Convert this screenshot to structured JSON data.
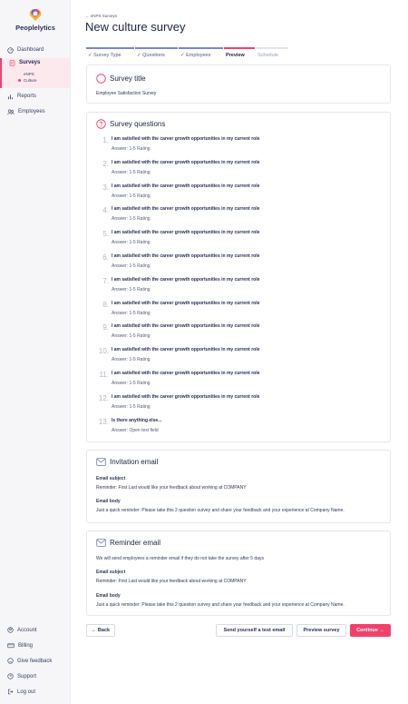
{
  "app": {
    "brand": "Peoplelytics"
  },
  "sidebar": {
    "items": [
      {
        "label": "Dashboard",
        "icon": "dashboard-icon"
      },
      {
        "label": "Surveys",
        "icon": "surveys-icon"
      },
      {
        "label": "Reports",
        "icon": "reports-icon"
      },
      {
        "label": "Employees",
        "icon": "employees-icon"
      }
    ],
    "survey_sub": [
      "eNPS",
      "Culture"
    ],
    "bottom": [
      {
        "label": "Account",
        "icon": "account-icon"
      },
      {
        "label": "Billing",
        "icon": "billing-icon"
      },
      {
        "label": "Give feedback",
        "icon": "feedback-icon"
      },
      {
        "label": "Support",
        "icon": "support-icon"
      },
      {
        "label": "Log out",
        "icon": "logout-icon"
      }
    ]
  },
  "header": {
    "breadcrumb": "← eNPS Surveys",
    "title": "New culture survey"
  },
  "steps": [
    {
      "label": "✓ Survey Type",
      "state": "done"
    },
    {
      "label": "✓ Questions",
      "state": "done"
    },
    {
      "label": "✓ Employees",
      "state": "done"
    },
    {
      "label": "Preview",
      "state": "active"
    },
    {
      "label": "Schedule",
      "state": "future"
    }
  ],
  "title_card": {
    "heading": "Survey title",
    "value": "Employee Satisfaction Survey"
  },
  "questions_card": {
    "heading": "Survey questions",
    "questions": [
      {
        "num": "1.",
        "text": "I am satisfied with the career growth opportunities in my current role",
        "answer": "Answer: 1-5 Rating"
      },
      {
        "num": "2.",
        "text": "I am satisfied with the career growth opportunities in my current role",
        "answer": "Answer: 1-5 Rating"
      },
      {
        "num": "3.",
        "text": "I am satisfied with the career growth opportunities in my current role",
        "answer": "Answer: 1-5 Rating"
      },
      {
        "num": "4.",
        "text": "I am satisfied with the career growth opportunities in my current role",
        "answer": "Answer: 1-5 Rating"
      },
      {
        "num": "5.",
        "text": "I am satisfied with the career growth opportunities in my current role",
        "answer": "Answer: 1-5 Rating"
      },
      {
        "num": "6.",
        "text": "I am satisfied with the career growth opportunities in my current role",
        "answer": "Answer: 1-5 Rating"
      },
      {
        "num": "7.",
        "text": "I am satisfied with the career growth opportunities in my current role",
        "answer": "Answer: 1-5 Rating"
      },
      {
        "num": "8.",
        "text": "I am satisfied with the career growth opportunities in my current role",
        "answer": "Answer: 1-5 Rating"
      },
      {
        "num": "9.",
        "text": "I am satisfied with the career growth opportunities in my current role",
        "answer": "Answer: 1-5 Rating"
      },
      {
        "num": "10.",
        "text": "I am satisfied with the career growth opportunities in my current role",
        "answer": "Answer: 1-5 Rating"
      },
      {
        "num": "11.",
        "text": "I am satisfied with the career growth opportunities in my current role",
        "answer": "Answer: 1-5 Rating"
      },
      {
        "num": "12.",
        "text": "I am satisfied with the career growth opportunities in my current role",
        "answer": "Answer: 1-5 Rating"
      },
      {
        "num": "13.",
        "text": "Is there anything else...",
        "answer": "Answer: Open text field"
      }
    ]
  },
  "invitation": {
    "heading": "Invitation email",
    "subject_label": "Email subject",
    "subject": "Reminder: First Last would like your feedback about working at COMPANY",
    "body_label": "Email body",
    "body": "Just a quick reminder: Please take this 2 question survey and share your feedback and your experience at Company Name."
  },
  "reminder": {
    "heading": "Reminder email",
    "intro": "We will send employees a reminder email if they do not take the survey after 5 days",
    "subject_label": "Email subject",
    "subject": "Reminder: First Last would like your feedback about working at COMPANY",
    "body_label": "Email body",
    "body": "Just a quick reminder: Please take this 2 question survey and share your feedback and your experience at Company Name."
  },
  "actions": {
    "back": "← Back",
    "test_email": "Send yourself a test email",
    "preview": "Preview survey",
    "continue": "Continue →"
  },
  "colors": {
    "accent": "#f0416c",
    "step_done": "#7b88c4",
    "text": "#1f2340"
  }
}
